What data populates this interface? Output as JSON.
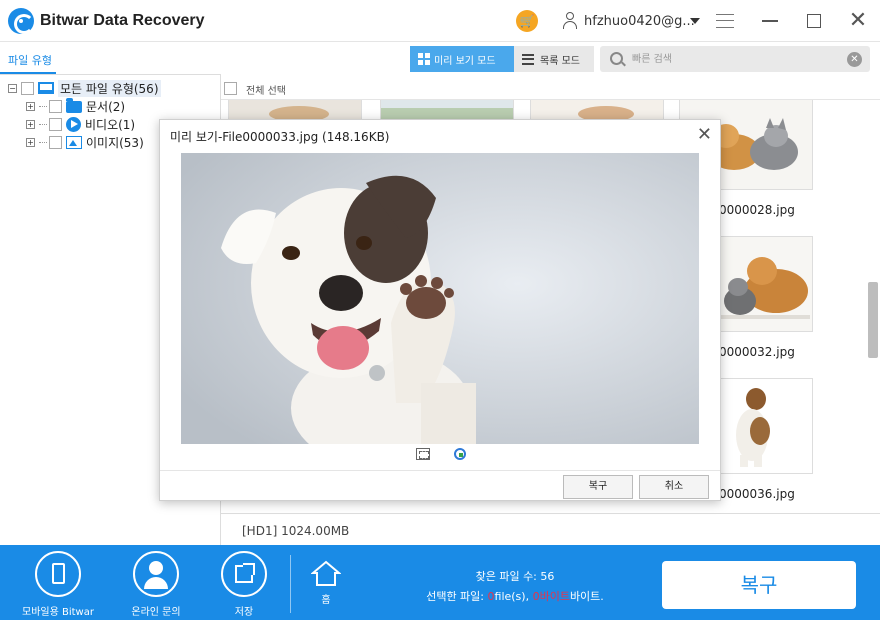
{
  "app": {
    "title": "Bitwar Data Recovery",
    "user": "hfzhuo0420@g..."
  },
  "left_panel": {
    "tab": "파일 유형",
    "tree": {
      "root": "모든 파일 유형(56)",
      "items": [
        {
          "label": "문서(2)",
          "icon": "folder-icon"
        },
        {
          "label": "비디오(1)",
          "icon": "video-icon"
        },
        {
          "label": "이미지(53)",
          "icon": "image-icon"
        }
      ]
    }
  },
  "toolbar": {
    "preview_mode": "미리 보기 모드",
    "list_mode": "목록 모드",
    "search_placeholder": "빠른 검색"
  },
  "content": {
    "select_all": "전체 선택",
    "files": [
      "0000028.jpg",
      "0000032.jpg",
      "0000036.jpg"
    ],
    "status": "[HD1] 1024.00MB"
  },
  "dialog": {
    "title": "미리 보기-File0000033.jpg (148.16KB)",
    "recover_button": "복구",
    "cancel_button": "취소"
  },
  "bottom": {
    "mobile_label": "모바일용 Bitwar",
    "online_label": "온라인 문의",
    "save_label": "저장",
    "home_label": "홈",
    "found_files": "찾은 파일 수: 56",
    "selected_prefix": "선택한 파일: ",
    "selected_count": "0",
    "selected_files_unit": "file(s), ",
    "selected_bytes": "0바이트",
    "selected_bytes_unit": "바이트.",
    "recover_button": "복구"
  },
  "colors": {
    "accent": "#1a8be6",
    "highlight_red": "#e8334a",
    "cart": "#f5a623"
  }
}
